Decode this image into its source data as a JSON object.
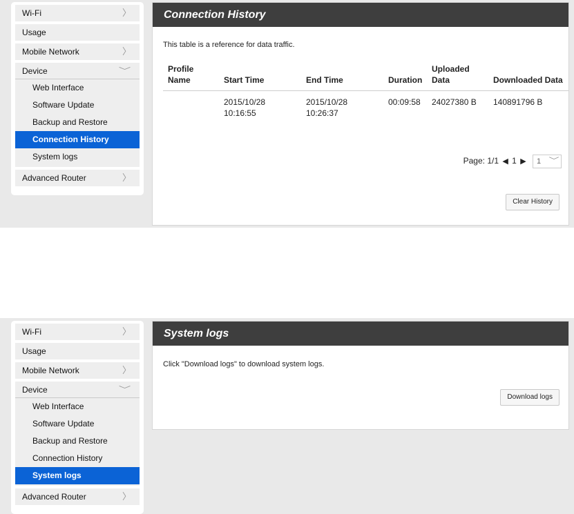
{
  "screens": [
    {
      "sidebar": {
        "items": [
          {
            "label": "Wi-Fi"
          },
          {
            "label": "Usage"
          },
          {
            "label": "Mobile Network"
          },
          {
            "label": "Device"
          },
          {
            "label": "Advanced Router"
          }
        ],
        "device_sub": [
          {
            "label": "Web Interface"
          },
          {
            "label": "Software Update"
          },
          {
            "label": "Backup and Restore"
          },
          {
            "label": "Connection History"
          },
          {
            "label": "System logs"
          }
        ]
      },
      "title": "Connection History",
      "description": "This table is a reference for data traffic.",
      "table": {
        "headers": [
          "Profile Name",
          "Start Time",
          "End Time",
          "Duration",
          "Uploaded Data",
          "Downloaded Data"
        ],
        "rows": [
          [
            "",
            "2015/10/28 10:16:55",
            "2015/10/28 10:26:37",
            "00:09:58",
            "24027380 B",
            "140891796 B"
          ]
        ]
      },
      "pager": {
        "label": "Page:",
        "position": "1/1",
        "current": "1",
        "select_value": "1"
      },
      "button": "Clear History"
    },
    {
      "sidebar": {
        "items": [
          {
            "label": "Wi-Fi"
          },
          {
            "label": "Usage"
          },
          {
            "label": "Mobile Network"
          },
          {
            "label": "Device"
          },
          {
            "label": "Advanced Router"
          }
        ],
        "device_sub": [
          {
            "label": "Web Interface"
          },
          {
            "label": "Software Update"
          },
          {
            "label": "Backup and Restore"
          },
          {
            "label": "Connection History"
          },
          {
            "label": "System logs"
          }
        ]
      },
      "title": "System logs",
      "description": "Click \"Download logs\" to download system logs.",
      "button": "Download logs"
    }
  ],
  "colors": {
    "active_nav": "#0b63d6",
    "header_bg": "#3e3e3e",
    "panel_bg": "#e9e9e9"
  },
  "icons": {
    "expand": "chevron-right-icon",
    "collapse": "chevron-down-icon",
    "prev": "triangle-left-icon",
    "next": "triangle-right-icon"
  }
}
